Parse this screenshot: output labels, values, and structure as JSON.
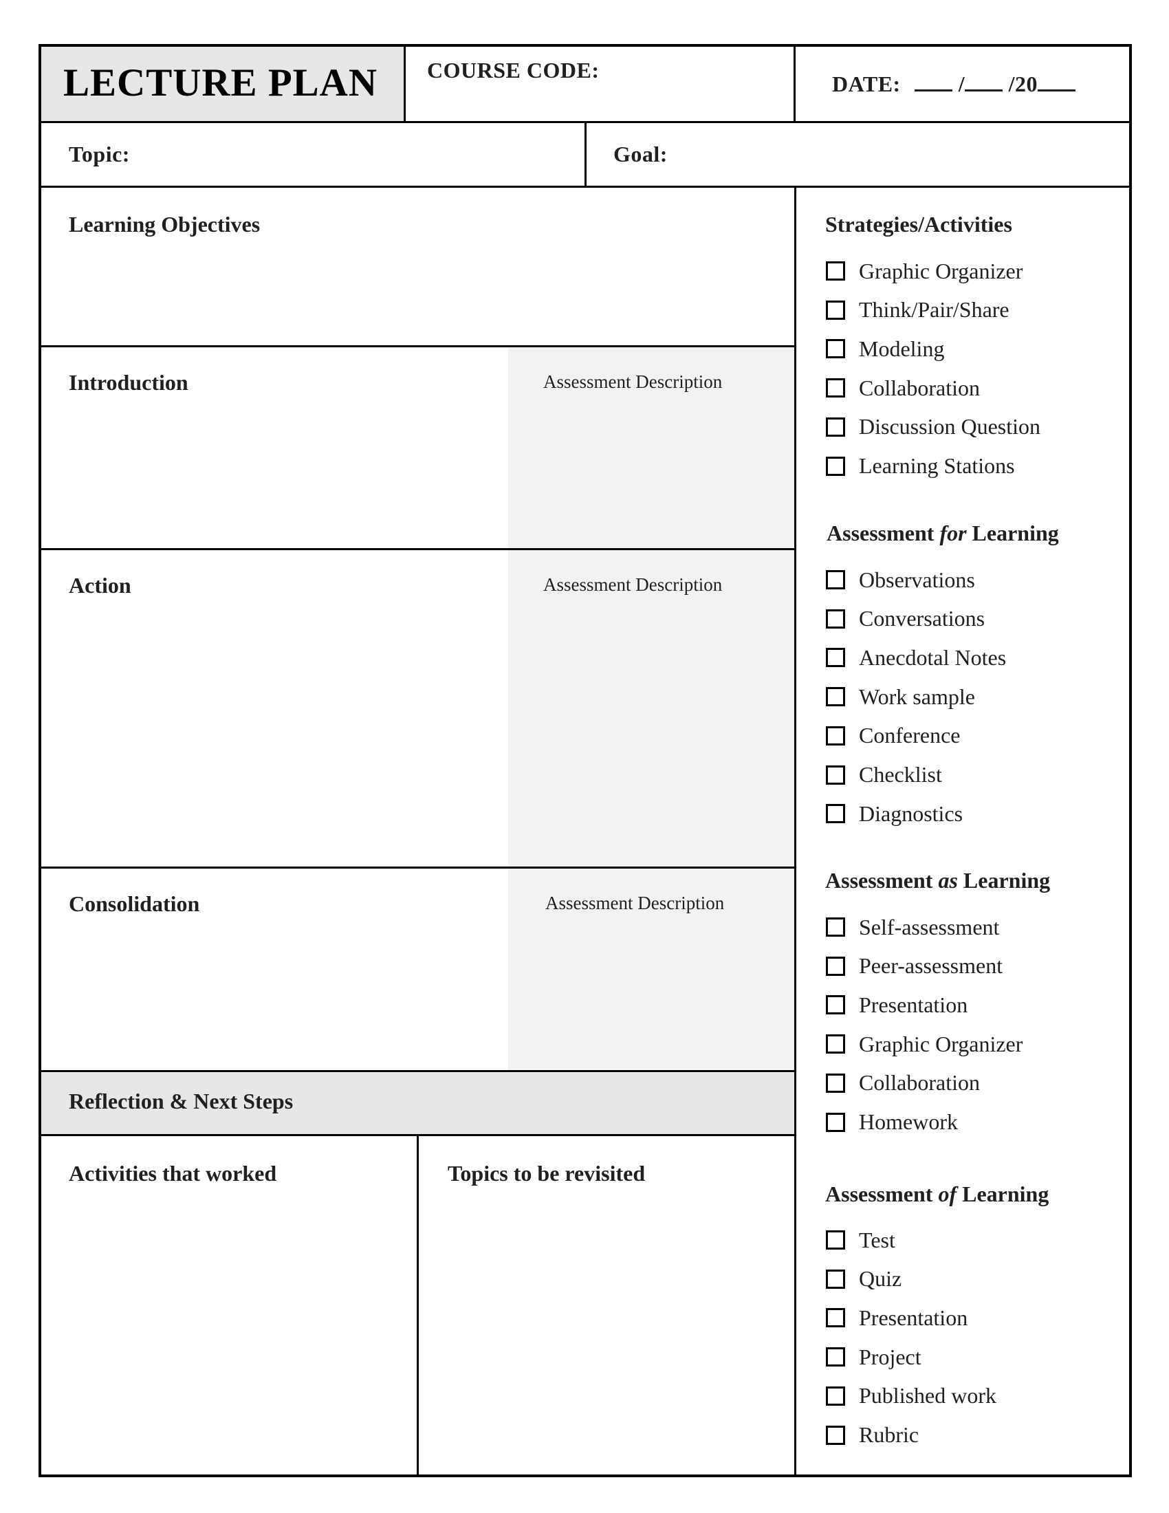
{
  "header": {
    "title": "LECTURE PLAN",
    "course_code_label": "COURSE CODE:",
    "date_label": "DATE:",
    "date_sep1": "/",
    "date_sep2": "/20",
    "course_code_value": "",
    "date_day": "",
    "date_month": "",
    "date_year": ""
  },
  "topic": {
    "label": "Topic:",
    "value": ""
  },
  "goal": {
    "label": "Goal:",
    "value": ""
  },
  "sections": {
    "learning_objectives": {
      "label": "Learning Objectives"
    },
    "introduction": {
      "label": "Introduction",
      "assessment_label": "Assessment Description"
    },
    "action": {
      "label": "Action",
      "assessment_label": "Assessment Description"
    },
    "consolidation": {
      "label": "Consolidation",
      "assessment_label": "Assessment Description"
    },
    "reflection": {
      "label": "Reflection & Next Steps"
    },
    "activities_worked": {
      "label": "Activities that worked"
    },
    "topics_revisit": {
      "label": "Topics to be revisited"
    }
  },
  "sidebar": {
    "groups": [
      {
        "heading_pre": "Strategies/Activities",
        "heading_em": "",
        "heading_post": "",
        "items": [
          {
            "label": "Graphic Organizer",
            "checked": false
          },
          {
            "label": "Think/Pair/Share",
            "checked": false
          },
          {
            "label": "Modeling",
            "checked": false
          },
          {
            "label": "Collaboration",
            "checked": false
          },
          {
            "label": "Discussion Question",
            "checked": false
          },
          {
            "label": "Learning Stations",
            "checked": false
          }
        ]
      },
      {
        "heading_pre": "Assessment ",
        "heading_em": "for",
        "heading_post": " Learning",
        "items": [
          {
            "label": "Observations",
            "checked": false
          },
          {
            "label": "Conversations",
            "checked": false
          },
          {
            "label": "Anecdotal Notes",
            "checked": false
          },
          {
            "label": "Work sample",
            "checked": false
          },
          {
            "label": "Conference",
            "checked": false
          },
          {
            "label": "Checklist",
            "checked": false
          },
          {
            "label": "Diagnostics",
            "checked": false
          }
        ]
      },
      {
        "heading_pre": "Assessment ",
        "heading_em": "as",
        "heading_post": " Learning",
        "items": [
          {
            "label": "Self-assessment",
            "checked": false
          },
          {
            "label": "Peer-assessment",
            "checked": false
          },
          {
            "label": "Presentation",
            "checked": false
          },
          {
            "label": "Graphic Organizer",
            "checked": false
          },
          {
            "label": "Collaboration",
            "checked": false
          },
          {
            "label": "Homework",
            "checked": false
          }
        ]
      },
      {
        "heading_pre": "Assessment ",
        "heading_em": "of",
        "heading_post": " Learning",
        "items": [
          {
            "label": "Test",
            "checked": false
          },
          {
            "label": "Quiz",
            "checked": false
          },
          {
            "label": "Presentation",
            "checked": false
          },
          {
            "label": "Project",
            "checked": false
          },
          {
            "label": "Published work",
            "checked": false
          },
          {
            "label": "Rubric",
            "checked": false
          }
        ]
      }
    ]
  }
}
